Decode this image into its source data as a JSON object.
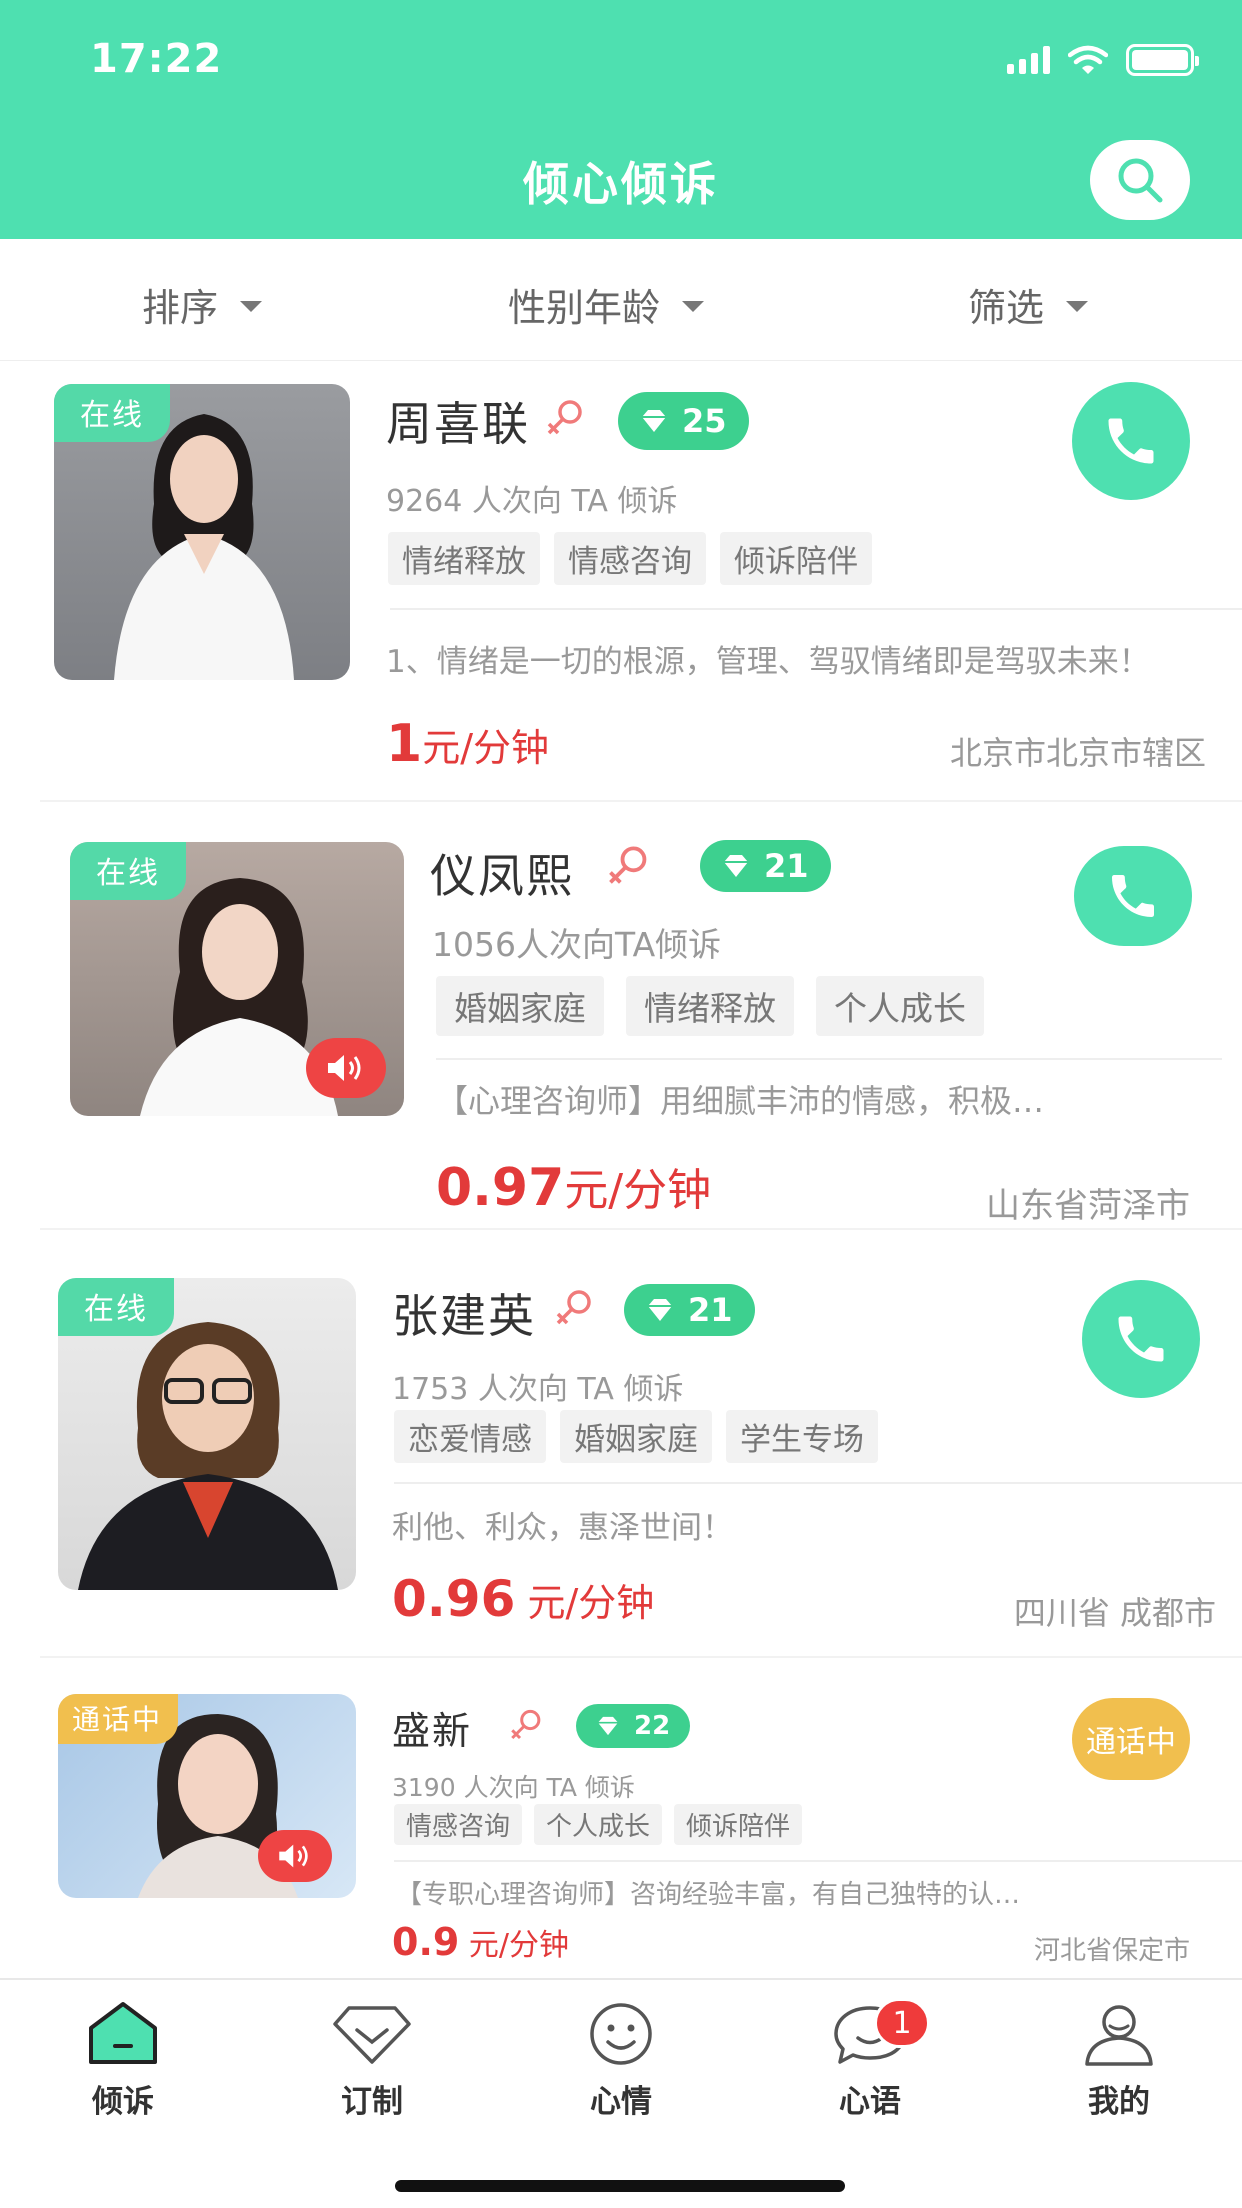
{
  "status_bar": {
    "time": "17:22"
  },
  "header": {
    "title": "倾心倾诉"
  },
  "filters": [
    {
      "label": "排序"
    },
    {
      "label": "性别年龄"
    },
    {
      "label": "筛选"
    }
  ],
  "listeners": [
    {
      "status": "在线",
      "name": "周喜联",
      "level": "25",
      "count": "9264 人次向 TA 倾诉",
      "tags": [
        "情绪释放",
        "情感咨询",
        "倾诉陪伴"
      ],
      "desc": "1、情绪是一切的根源，管理、驾驭情绪即是驾驭未来！",
      "price_num": "1",
      "price_unit": "元/分钟",
      "location": "北京市北京市辖区"
    },
    {
      "status": "在线",
      "name": "仪凤熙",
      "level": "21",
      "count": "1056人次向TA倾诉",
      "tags": [
        "婚姻家庭",
        "情绪释放",
        "个人成长"
      ],
      "desc": "【心理咨询师】用细腻丰沛的情感，积极…",
      "price_num": "0.97",
      "price_unit": "元/分钟",
      "location": "山东省菏泽市"
    },
    {
      "status": "在线",
      "name": "张建英",
      "level": "21",
      "count": "1753 人次向 TA 倾诉",
      "tags": [
        "恋爱情感",
        "婚姻家庭",
        "学生专场"
      ],
      "desc": "利他、利众，惠泽世间！",
      "price_num": "0.96",
      "price_unit": " 元/分钟",
      "location": "四川省 成都市"
    },
    {
      "status": "通话中",
      "name": "盛新",
      "level": "22",
      "count": "3190 人次向 TA 倾诉",
      "tags": [
        "情感咨询",
        "个人成长",
        "倾诉陪伴"
      ],
      "desc": "【专职心理咨询师】咨询经验丰富，有自己独特的认…",
      "price_num": "0.9",
      "price_unit": " 元/分钟",
      "location": "河北省保定市",
      "busy_label": "通话中"
    }
  ],
  "tabbar": {
    "items": [
      {
        "label": "倾诉",
        "icon": "home-icon"
      },
      {
        "label": "订制",
        "icon": "diamond-icon"
      },
      {
        "label": "心情",
        "icon": "smile-icon"
      },
      {
        "label": "心语",
        "icon": "chat-icon",
        "badge": "1"
      },
      {
        "label": "我的",
        "icon": "profile-icon"
      }
    ]
  },
  "colors": {
    "brand": "#4ee0b0",
    "price": "#e23a3a",
    "busy": "#f1bf4e",
    "badge": "#ef3b3b"
  }
}
